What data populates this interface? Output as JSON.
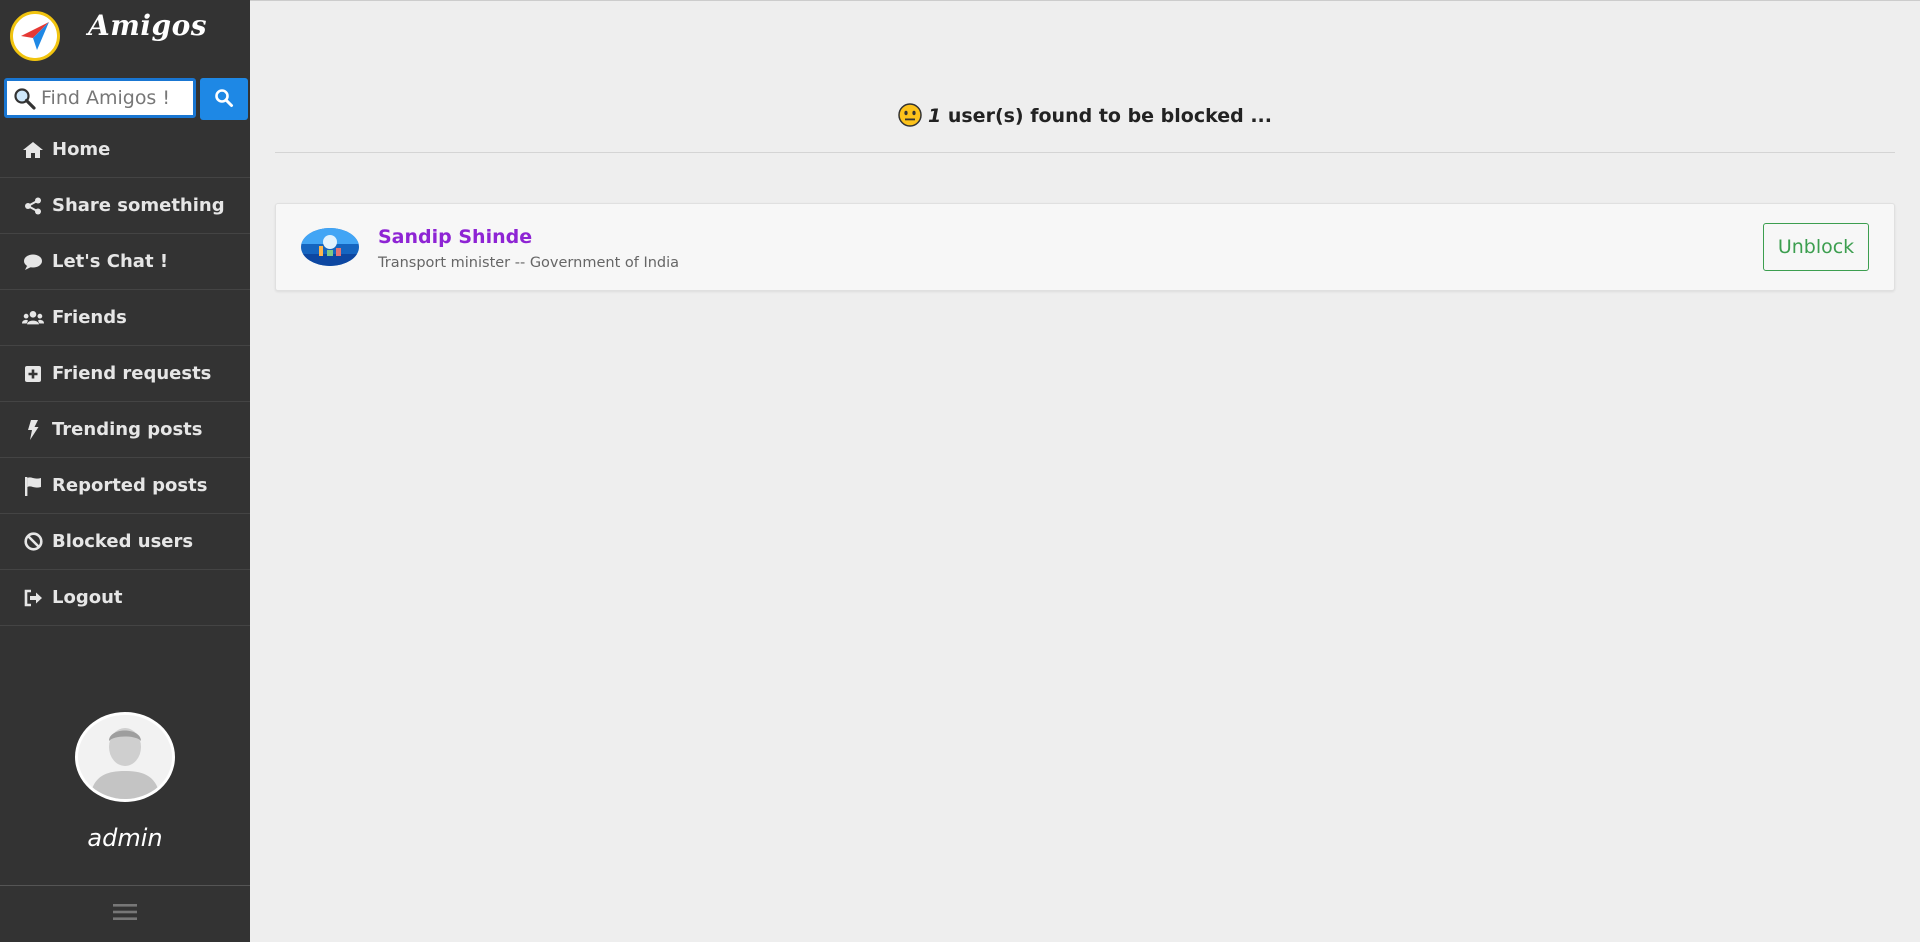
{
  "brand": {
    "name": "Amigos"
  },
  "search": {
    "placeholder": "Find Amigos !"
  },
  "nav": {
    "items": [
      {
        "label": "Home",
        "icon": "home-icon"
      },
      {
        "label": "Share something",
        "icon": "share-icon"
      },
      {
        "label": "Let's Chat !",
        "icon": "chat-icon"
      },
      {
        "label": "Friends",
        "icon": "users-icon"
      },
      {
        "label": "Friend requests",
        "icon": "plus-square-icon"
      },
      {
        "label": "Trending posts",
        "icon": "bolt-icon"
      },
      {
        "label": "Reported posts",
        "icon": "flag-icon"
      },
      {
        "label": "Blocked users",
        "icon": "ban-icon"
      },
      {
        "label": "Logout",
        "icon": "sign-out-icon"
      }
    ]
  },
  "profile": {
    "username": "admin"
  },
  "main": {
    "headline_count": "1",
    "headline_text": " user(s) found to be blocked ...",
    "blocked_users": [
      {
        "name": "Sandip Shinde",
        "description": "Transport minister -- Government of India",
        "action_label": "Unblock"
      }
    ]
  },
  "colors": {
    "sidebar_bg": "#333333",
    "search_accent": "#1e88e5",
    "name_link": "#8e24d4",
    "unblock": "#3c9e4f",
    "page_bg": "#eeeeee"
  }
}
